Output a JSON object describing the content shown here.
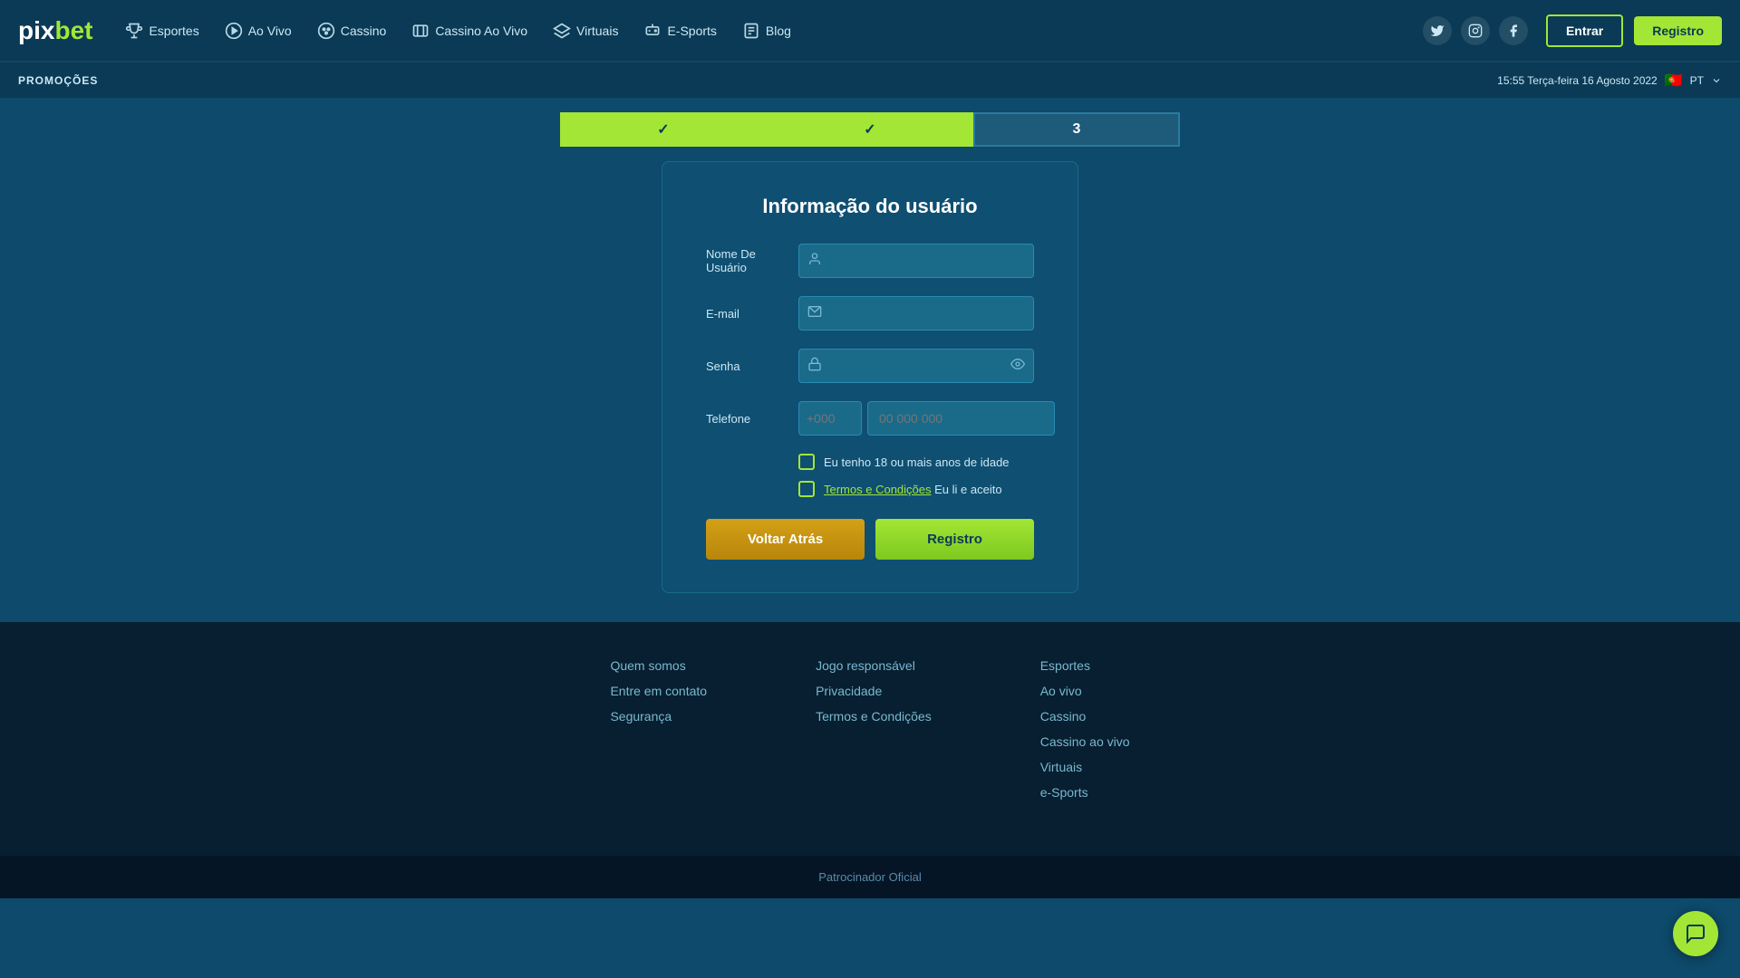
{
  "header": {
    "logo": "pixbet",
    "logo_pix": "pix",
    "logo_bet": "bet",
    "nav": [
      {
        "label": "Esportes",
        "icon": "trophy-icon"
      },
      {
        "label": "Ao Vivo",
        "icon": "play-icon"
      },
      {
        "label": "Cassino",
        "icon": "casino-icon"
      },
      {
        "label": "Cassino Ao Vivo",
        "icon": "casino-live-icon"
      },
      {
        "label": "Virtuais",
        "icon": "virtual-icon"
      },
      {
        "label": "E-Sports",
        "icon": "esports-icon"
      },
      {
        "label": "Blog",
        "icon": "blog-icon"
      }
    ],
    "btn_entrar": "Entrar",
    "btn_registro": "Registro"
  },
  "promo_bar": {
    "label": "PROMOÇÕES",
    "datetime": "15:55 Terça-feira 16 Agosto 2022",
    "lang": "PT"
  },
  "steps": [
    {
      "label": "✓",
      "state": "done"
    },
    {
      "label": "✓",
      "state": "done"
    },
    {
      "label": "3",
      "state": "current"
    }
  ],
  "form": {
    "title": "Informação do usuário",
    "fields": {
      "username_label": "Nome De Usuário",
      "username_placeholder": "",
      "email_label": "E-mail",
      "email_placeholder": "",
      "senha_label": "Senha",
      "senha_placeholder": "",
      "telefone_label": "Telefone",
      "phone_code_placeholder": "+000",
      "phone_number_placeholder": "00 000 000"
    },
    "checkbox1": "Eu tenho 18 ou mais anos de idade",
    "checkbox2_link": "Termos e Condições",
    "checkbox2_rest": " Eu li e aceito",
    "btn_voltar": "Voltar Atrás",
    "btn_registro": "Registro"
  },
  "footer": {
    "col1": [
      {
        "label": "Quem somos"
      },
      {
        "label": "Entre em contato"
      },
      {
        "label": "Segurança"
      }
    ],
    "col2": [
      {
        "label": "Jogo responsável"
      },
      {
        "label": "Privacidade"
      },
      {
        "label": "Termos e Condições"
      }
    ],
    "col3": [
      {
        "label": "Esportes"
      },
      {
        "label": "Ao vivo"
      },
      {
        "label": "Cassino"
      },
      {
        "label": "Cassino ao vivo"
      },
      {
        "label": "Virtuais"
      },
      {
        "label": "e-Sports"
      }
    ],
    "patrocinador": "Patrocinador Oficial"
  }
}
